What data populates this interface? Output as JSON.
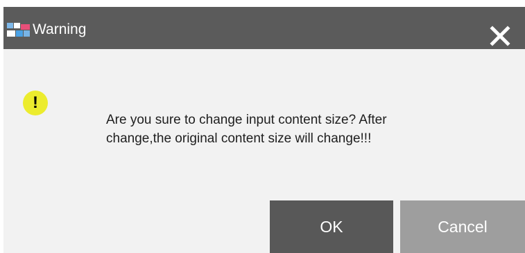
{
  "dialog": {
    "title": "Warning",
    "app_icon": "app-logo-icon",
    "close_icon": "close-icon",
    "warning_icon": "exclamation-icon",
    "warning_symbol": "!",
    "message": "Are you sure to change input content size? After\nchange,the original content size will change!!!",
    "buttons": {
      "ok": "OK",
      "cancel": "Cancel"
    },
    "colors": {
      "titlebar": "#5b5b5b",
      "body": "#f2f2f2",
      "ok_button": "#585858",
      "cancel_button": "#9e9e9e",
      "warning_icon": "#ecec2e"
    }
  }
}
